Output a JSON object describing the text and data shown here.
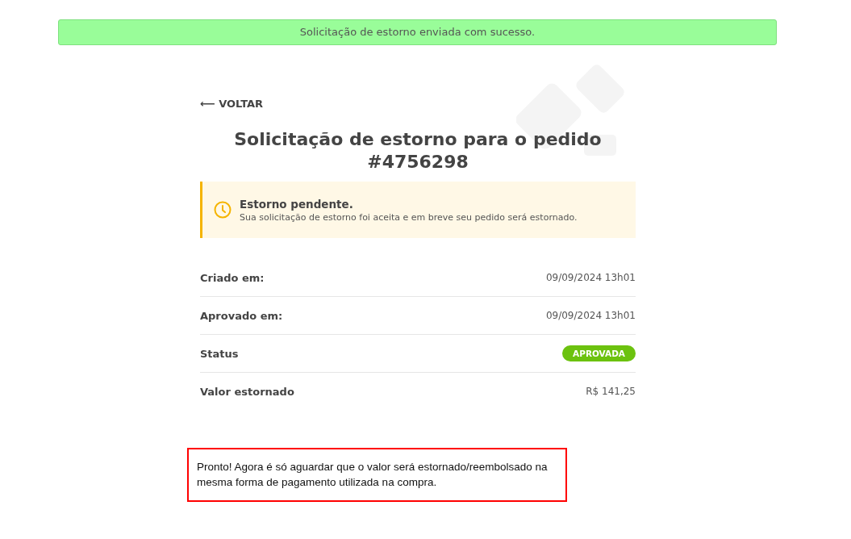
{
  "banner": {
    "text": "Solicitação de estorno enviada com sucesso."
  },
  "back_link": {
    "arrow": "⟵",
    "label": "VOLTAR"
  },
  "title": "Solicitação de estorno para o pedido #4756298",
  "alert": {
    "kind": "pending",
    "title": "Estorno pendente.",
    "message": "Sua solicitação de estorno foi aceita e em breve seu pedido será estornado."
  },
  "details": [
    {
      "kind": "text",
      "label": "Criado em:",
      "value": "09/09/2024 13h01"
    },
    {
      "kind": "text",
      "label": "Aprovado em:",
      "value": "09/09/2024 13h01"
    },
    {
      "kind": "badge",
      "label": "Status",
      "value": "APROVADA"
    },
    {
      "kind": "text",
      "label": "Valor estornado",
      "value": "R$ 141,25"
    }
  ],
  "note": "Pronto! Agora é só aguardar que o valor será estornado/reembolsado na mesma forma de pagamento utilizada na compra."
}
